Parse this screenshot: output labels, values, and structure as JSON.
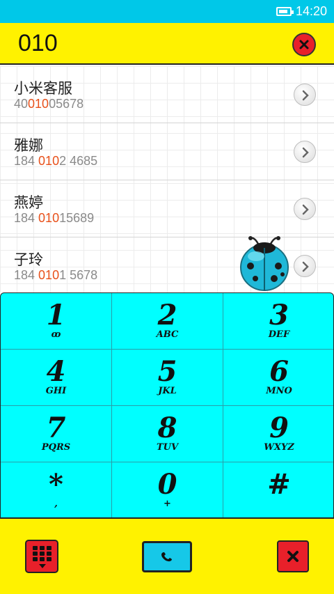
{
  "status_bar": {
    "time": "14:20",
    "battery_level": 0.85
  },
  "dial_input": {
    "value": "010"
  },
  "contacts": [
    {
      "name": "小米客服",
      "number_before": "40",
      "number_match": "010",
      "number_after": "05678"
    },
    {
      "name": "雅娜",
      "number_before": "184 ",
      "number_match": "010",
      "number_after": "2 4685"
    },
    {
      "name": "燕婷",
      "number_before": "184 ",
      "number_match": "010",
      "number_after": "15689"
    },
    {
      "name": "子玲",
      "number_before": "184 ",
      "number_match": "010",
      "number_after": "1 5678"
    }
  ],
  "keypad": {
    "keys": [
      {
        "digit": "1",
        "letters": "ꝏ"
      },
      {
        "digit": "2",
        "letters": "ABC"
      },
      {
        "digit": "3",
        "letters": "DEF"
      },
      {
        "digit": "4",
        "letters": "GHI"
      },
      {
        "digit": "5",
        "letters": "JKL"
      },
      {
        "digit": "6",
        "letters": "MNO"
      },
      {
        "digit": "7",
        "letters": "PQRS"
      },
      {
        "digit": "8",
        "letters": "TUV"
      },
      {
        "digit": "9",
        "letters": "WXYZ"
      },
      {
        "digit": "*",
        "letters": ","
      },
      {
        "digit": "0",
        "letters": "+"
      },
      {
        "digit": "#",
        "letters": ""
      }
    ]
  },
  "bottom_bar": {
    "buttons": [
      {
        "icon": "keypad-toggle-icon"
      },
      {
        "icon": "phone-call-icon"
      },
      {
        "icon": "close-icon"
      }
    ]
  },
  "colors": {
    "status_bar": "#00c8e8",
    "header_yellow": "#fff200",
    "keypad_cyan": "#00ffff",
    "match_highlight": "#e8501a",
    "button_red": "#e8202a"
  }
}
